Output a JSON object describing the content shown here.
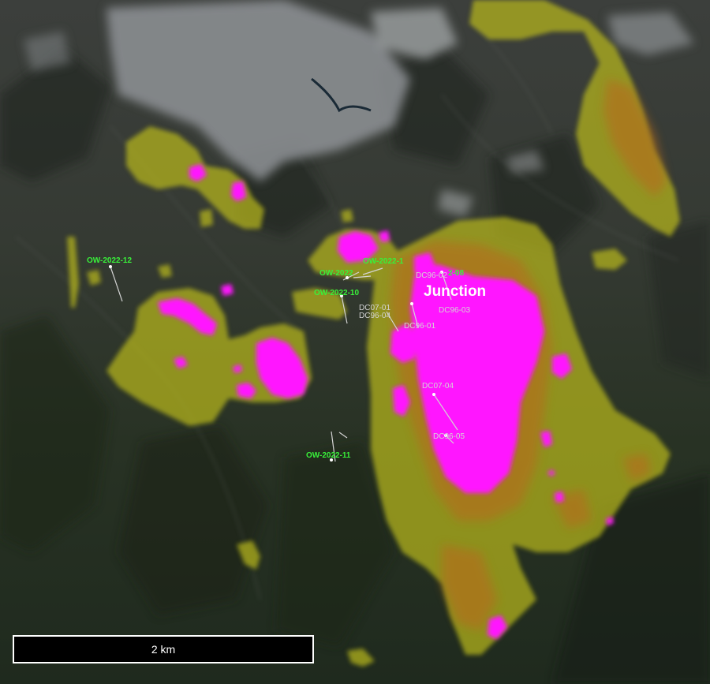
{
  "map": {
    "target_label": "Junction",
    "scale_label": "2 km",
    "drill_holes_green": [
      {
        "id": "ow-2022-12",
        "label": "OW-2022-12"
      },
      {
        "id": "ow-2022-upper",
        "label": "OW-2022"
      },
      {
        "id": "ow-2022-a",
        "label": "OW-2022-1"
      },
      {
        "id": "ow-2022-b",
        "label": "2-08"
      },
      {
        "id": "ow-2022-10",
        "label": "OW-2022-10"
      },
      {
        "id": "ow-2022-11",
        "label": "OW-2022-11"
      }
    ],
    "drill_holes_grey": [
      {
        "id": "dc07-01",
        "label": "DC07-01"
      },
      {
        "id": "dc96-04",
        "label": "DC96-04"
      },
      {
        "id": "dc96-01",
        "label": "DC96-01"
      },
      {
        "id": "dc96-03",
        "label": "DC96-03"
      },
      {
        "id": "dc96-02",
        "label": "DC96-02"
      },
      {
        "id": "dc07-04",
        "label": "DC07-04"
      },
      {
        "id": "dc96-05",
        "label": "DC96-05"
      }
    ],
    "colors": {
      "anomaly_high": "#ff14ff",
      "anomaly_mid": "#b86a1f",
      "anomaly_low": "#b8b81c",
      "drill_green": "#39f03a",
      "drill_grey": "#d4d4d4"
    }
  }
}
